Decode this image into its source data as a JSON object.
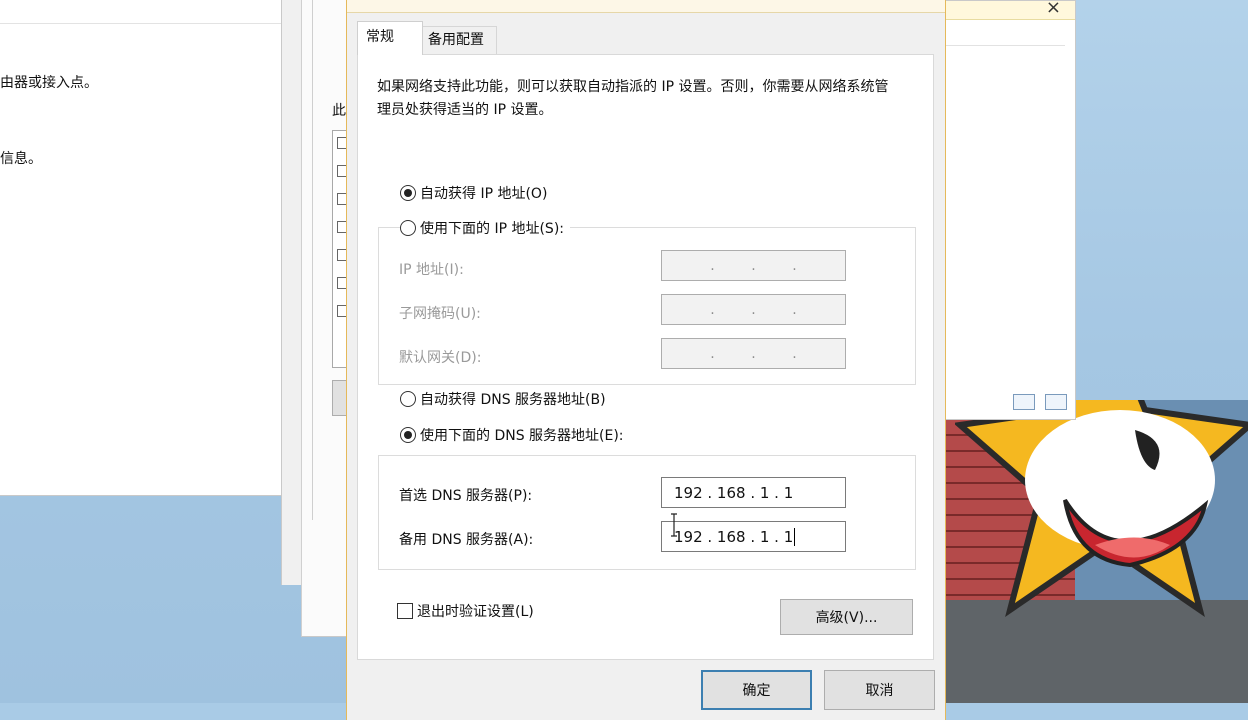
{
  "background_windows": {
    "left_text_1": "由器或接入点。",
    "left_text_2": "信息。",
    "mid_label": "此",
    "right_close": "×"
  },
  "dialog": {
    "tabs": [
      {
        "label": "常规",
        "active": true
      },
      {
        "label": "备用配置",
        "active": false
      }
    ],
    "description": "如果网络支持此功能，则可以获取自动指派的 IP 设置。否则，你需要从网络系统管理员处获得适当的 IP 设置。",
    "ip": {
      "auto_label": "自动获得 IP 地址(O)",
      "auto_checked": true,
      "manual_label": "使用下面的 IP 地址(S):",
      "manual_checked": false,
      "fields": [
        {
          "label": "IP 地址(I):",
          "value": ".   .   ."
        },
        {
          "label": "子网掩码(U):",
          "value": ".   .   ."
        },
        {
          "label": "默认网关(D):",
          "value": ".   .   ."
        }
      ]
    },
    "dns": {
      "auto_label": "自动获得 DNS 服务器地址(B)",
      "auto_checked": false,
      "manual_label": "使用下面的 DNS 服务器地址(E):",
      "manual_checked": true,
      "preferred_label": "首选 DNS 服务器(P):",
      "preferred_value": "192 . 168 .  1  .  1",
      "alternate_label": "备用 DNS 服务器(A):",
      "alternate_value": "192 . 168 .  1  .  1"
    },
    "validate_label": "退出时验证设置(L)",
    "validate_checked": false,
    "advanced_button": "高级(V)...",
    "ok_button": "确定",
    "cancel_button": "取消"
  },
  "colors": {
    "dialog_border": "#e5b95a",
    "ok_border": "#3c7fb1",
    "wallpaper_star": "#f5b820"
  }
}
